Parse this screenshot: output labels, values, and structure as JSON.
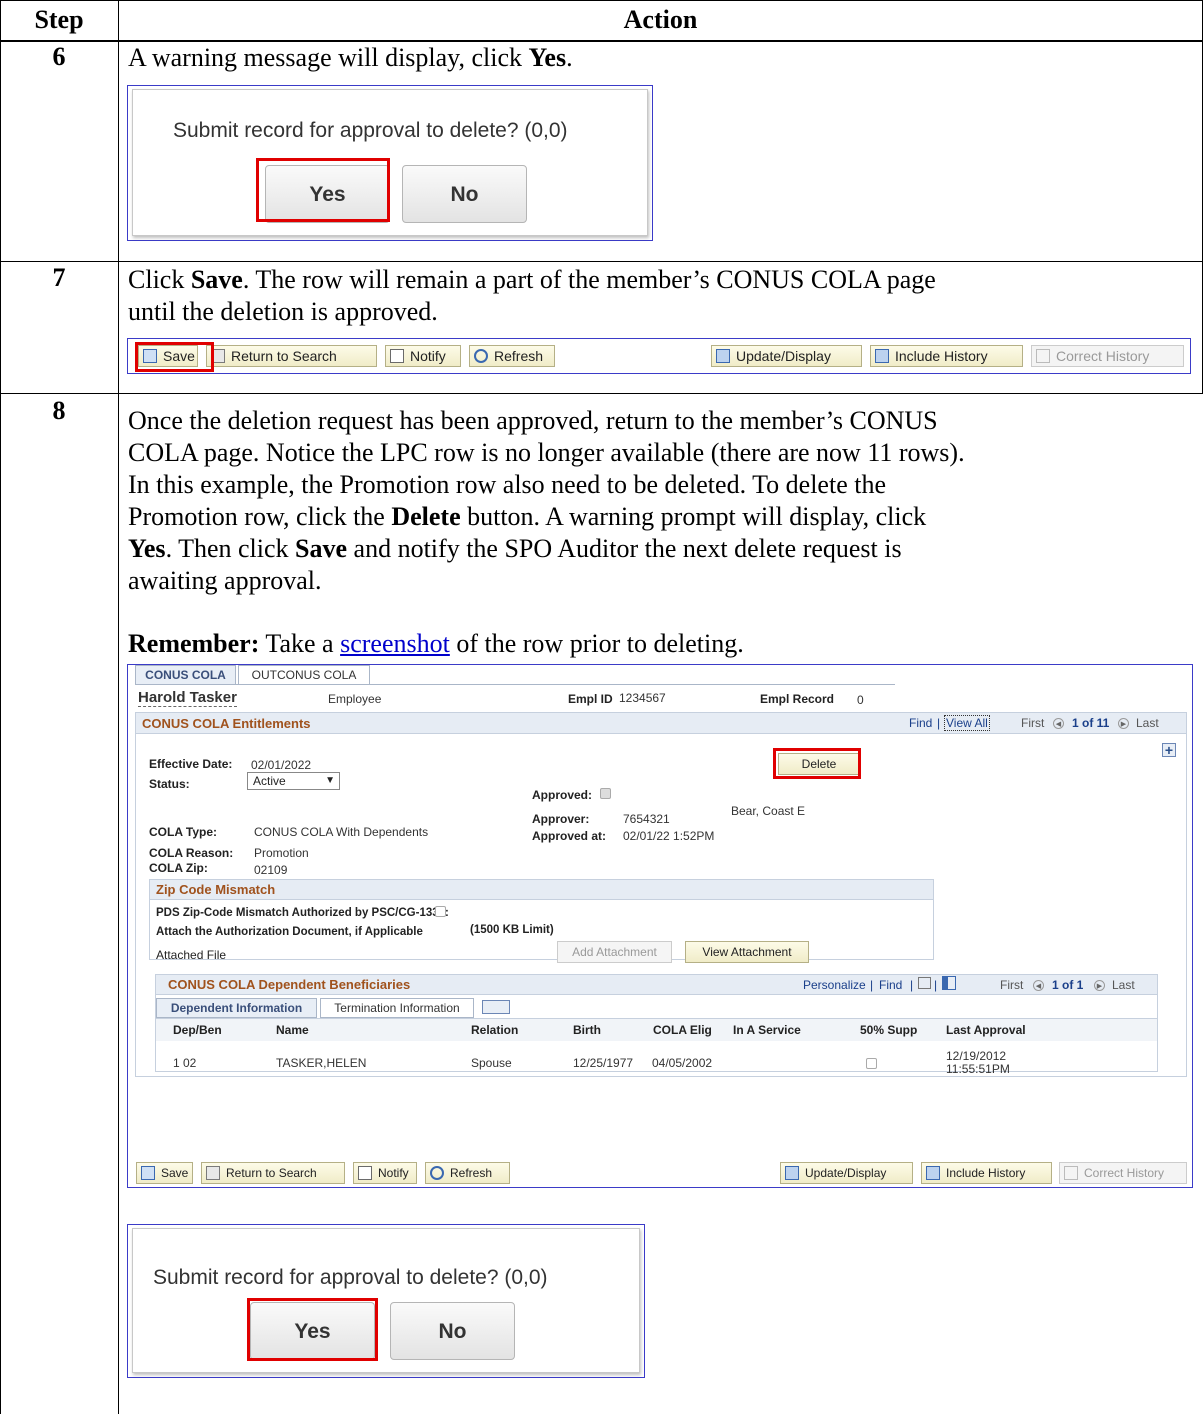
{
  "table": {
    "headers": [
      "Step",
      "Action"
    ],
    "steps": [
      {
        "num": "6"
      },
      {
        "num": "7"
      },
      {
        "num": "8"
      }
    ]
  },
  "step6": {
    "pre": "A warning message will display, click ",
    "bold": "Yes",
    "post": "."
  },
  "step7": {
    "line1_bold": "Click ",
    "line1_save": "Save",
    "line1_rest": ".  The row will remain a part of the member’s CONUS COLA page",
    "line2": "until the deletion is approved."
  },
  "step8": {
    "l1": "Once the deletion request has been approved, return to the member’s CONUS",
    "l2": "COLA page.  Notice the LPC row is no longer available (there are now 11 rows).",
    "l3": "In this example, the Promotion row also need to be deleted.  To delete the",
    "l4_a": "Promotion row, click the ",
    "l4_b": "Delete",
    "l4_c": " button.  A warning prompt will display, click",
    "l5_a": "Yes",
    "l5_b": ".  Then click ",
    "l5_c": "Save",
    "l5_d": " and notify the SPO Auditor the next delete request is",
    "l6": "awaiting approval.",
    "remember_bold": "Remember:",
    "remember_a": "  Take a ",
    "remember_link": "screenshot",
    "remember_b": " of the row prior to deleting."
  },
  "dialog": {
    "message": "Submit record for approval to delete? (0,0)",
    "yes": "Yes",
    "no": "No"
  },
  "toolbar": {
    "save": "Save",
    "return": "Return to Search",
    "notify": "Notify",
    "refresh": "Refresh",
    "update": "Update/Display",
    "history": "Include History",
    "correct": "Correct History"
  },
  "panel": {
    "tabs": [
      "CONUS COLA",
      "OUTCONUS COLA"
    ],
    "name": "Harold Tasker",
    "employee": "Employee",
    "emplid_label": "Empl ID",
    "emplid": "1234567",
    "emplrec_label": "Empl Record",
    "emplrec": "0",
    "section": "CONUS COLA Entitlements",
    "find": "Find",
    "viewall": "View All",
    "first": "First",
    "count": "1 of 11",
    "last": "Last",
    "effdate_label": "Effective Date:",
    "effdate": "02/01/2022",
    "status_label": "Status:",
    "status": "Active",
    "delete": "Delete",
    "approved_label": "Approved:",
    "approver_label": "Approver:",
    "approver_id": "7654321",
    "approver_name": "Bear, Coast E",
    "approved_at_label": "Approved at:",
    "approved_at": "02/01/22  1:52PM",
    "cola_type_label": "COLA Type:",
    "cola_type": "CONUS COLA With Dependents",
    "cola_reason_label": "COLA Reason:",
    "cola_reason": "Promotion",
    "cola_zip_label": "COLA Zip:",
    "cola_zip": "02109",
    "zip_section": "Zip Code Mismatch",
    "pds_label": "PDS Zip-Code Mismatch Authorized by PSC/CG-1332:",
    "attach_label": "Attach the Authorization Document, if Applicable",
    "attach_limit": "(1500 KB Limit)",
    "attached_file": "Attached File",
    "add_attachment": "Add Attachment",
    "view_attachment": "View Attachment",
    "dep_section": "CONUS COLA Dependent Beneficiaries",
    "personalize": "Personalize",
    "dep_find": "Find",
    "dep_count": "1 of 1",
    "dep_tabs": [
      "Dependent Information",
      "Termination Information"
    ],
    "columns": [
      "Dep/Ben",
      "Name",
      "Relation",
      "Birth",
      "COLA Elig",
      "In A Service",
      "50% Supp",
      "Last Approval"
    ],
    "row": {
      "idx": "1",
      "depben": "02",
      "name": "TASKER,HELEN",
      "relation": "Spouse",
      "birth": "12/25/1977",
      "cola_elig": "04/05/2002",
      "approval_1": "12/19/2012",
      "approval_2": "11:55:51PM"
    }
  }
}
